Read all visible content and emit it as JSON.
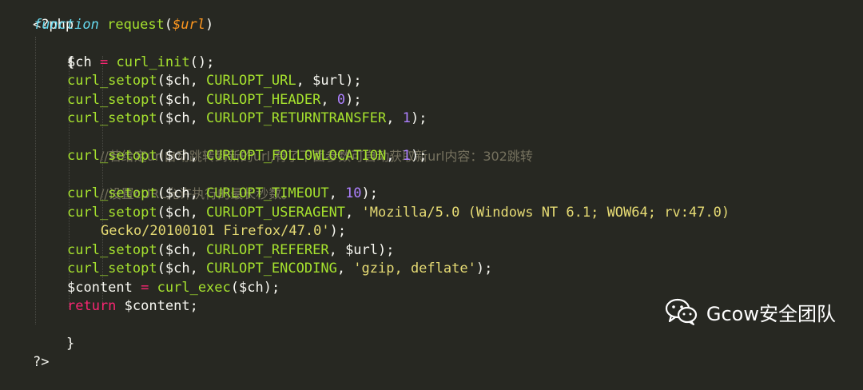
{
  "code": {
    "open_tag": "<?php",
    "close_tag": "?>",
    "fn_keyword": "function",
    "fn_name": "request",
    "fn_param": "$url",
    "open_brace": "{",
    "close_brace": "}",
    "lines": {
      "l3_var": "$ch",
      "l3_eq": "=",
      "l3_call": "curl_init",
      "setopt": "curl_setopt",
      "ch": "$ch",
      "opt_url": "CURLOPT_URL",
      "url_var": "$url",
      "opt_header": "CURLOPT_HEADER",
      "zero": "0",
      "opt_return": "CURLOPT_RETURNTRANSFER",
      "one": "1",
      "comment1": "//若给定url自动跳转到新的url,有了下面参数可自动获取新url内容：302跳转",
      "opt_follow": "CURLOPT_FOLLOWLOCATION",
      "comment2": "//设置cURL允许执行的最长秒数。",
      "opt_timeout": "CURLOPT_TIMEOUT",
      "ten": "10",
      "opt_ua": "CURLOPT_USERAGENT",
      "ua_part1": "'Mozilla/5.0 (Windows NT 6.1; WOW64; rv:47.0)",
      "ua_part2": "Gecko/20100101 Firefox/47.0'",
      "opt_referer": "CURLOPT_REFERER",
      "opt_encoding": "CURLOPT_ENCODING",
      "encoding_val": "'gzip, deflate'",
      "content_var": "$content",
      "exec_call": "curl_exec",
      "return_kw": "return"
    }
  },
  "watermark": {
    "label": "Gcow安全团队",
    "icon": "wechat-icon"
  }
}
